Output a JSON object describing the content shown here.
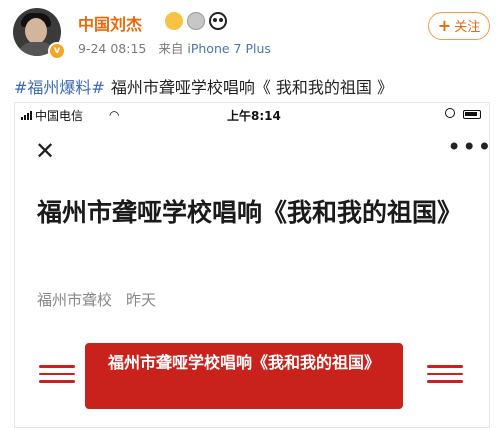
{
  "post": {
    "username": "中国刘杰",
    "date": "9-24 08:15",
    "source_prefix": "来自",
    "source": "iPhone 7 Plus",
    "follow_label": "关注",
    "hashtag": "#福州爆料#",
    "text": "福州市聋哑学校唱响《 我和我的祖国 》",
    "badges": [
      "crown-badge-icon",
      "medal-badge-icon",
      "panda-badge-icon"
    ]
  },
  "phone": {
    "carrier": "中国电信",
    "time": "上午8:14"
  },
  "article": {
    "title": "福州市聋哑学校唱响《我和我的祖国》",
    "author": "福州市聋校",
    "date": "昨天",
    "banner": "福州市聋哑学校唱响《我和我的祖国》"
  }
}
